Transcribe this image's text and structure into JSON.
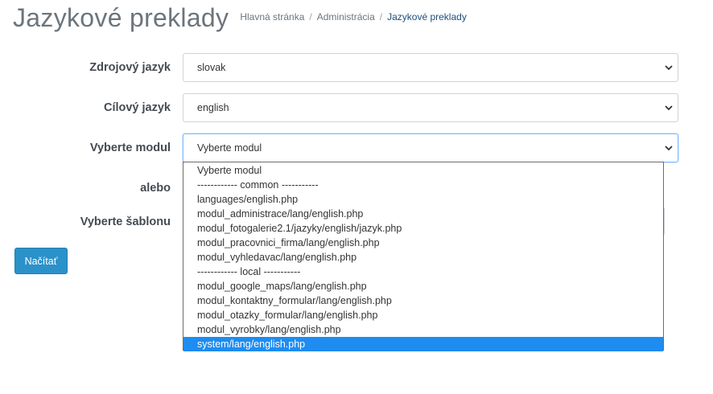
{
  "header": {
    "title": "Jazykové preklady",
    "breadcrumb": [
      {
        "label": "Hlavná stránka",
        "active": false
      },
      {
        "label": "Administrácia",
        "active": false
      },
      {
        "label": "Jazykové preklady",
        "active": true
      }
    ],
    "separator": "/"
  },
  "form": {
    "source_language": {
      "label": "Zdrojový jazyk",
      "value": "slovak"
    },
    "target_language": {
      "label": "Cílový jazyk",
      "value": "english"
    },
    "module": {
      "label": "Vyberte modul",
      "value": "Vyberte modul"
    },
    "or_label": "alebo",
    "template": {
      "label": "Vyberte šablonu",
      "value": ""
    },
    "submit_label": "Načítať"
  },
  "module_dropdown": {
    "options": [
      "Vyberte modul",
      "------------ common -----------",
      "languages/english.php",
      "modul_administrace/lang/english.php",
      "modul_fotogalerie2.1/jazyky/english/jazyk.php",
      "modul_pracovnici_firma/lang/english.php",
      "modul_vyhledavac/lang/english.php",
      "------------ local -----------",
      "modul_google_maps/lang/english.php",
      "modul_kontaktny_formular/lang/english.php",
      "modul_otazky_formular/lang/english.php",
      "modul_vyrobky/lang/english.php",
      "system/lang/english.php"
    ],
    "highlighted": "system/lang/english.php"
  },
  "colors": {
    "primary_button": "#2b91c9",
    "selection_highlight": "#1e8cf0",
    "focus_border": "#80bdff"
  },
  "icons": {
    "select_arrow": "chevron-down-icon"
  }
}
